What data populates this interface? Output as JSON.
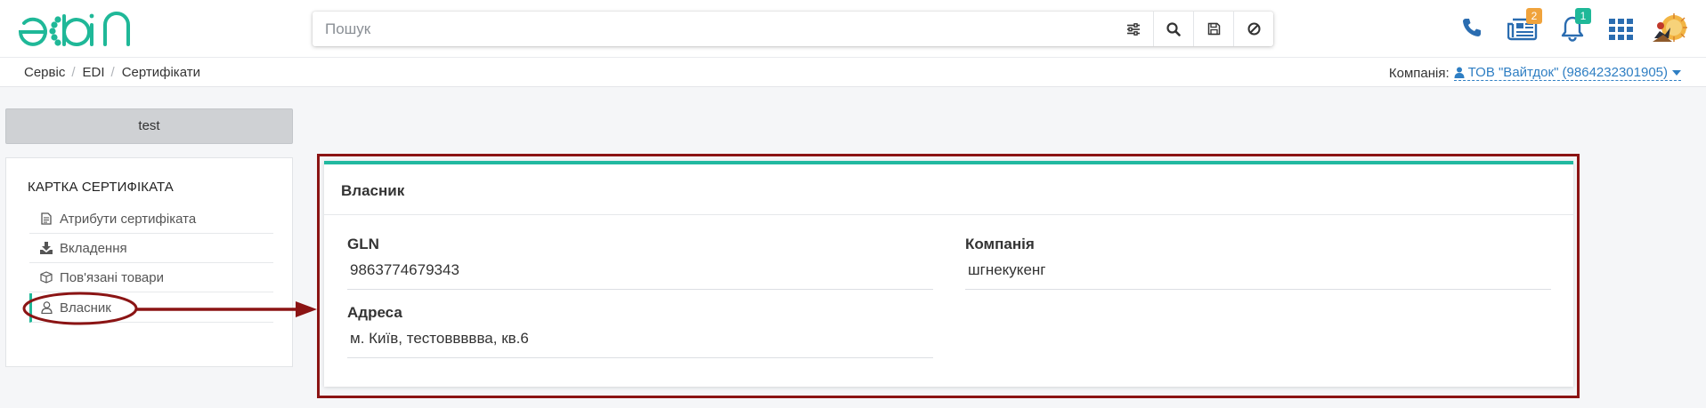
{
  "header": {
    "logo_text": "edin",
    "search": {
      "placeholder": "Пошук",
      "value": ""
    },
    "search_buttons": [
      "filter-icon",
      "search-icon",
      "save-icon",
      "clear-icon"
    ],
    "icons": {
      "phone": "phone-icon",
      "news": {
        "icon": "news-icon",
        "badge": "2",
        "badge_color": "#f0a33c"
      },
      "notifications": {
        "icon": "bell-icon",
        "badge": "1",
        "badge_color": "#1fb898"
      },
      "apps": "apps-grid-icon",
      "avatar": "avatar"
    }
  },
  "breadcrumb": {
    "items": [
      "Сервіс",
      "EDI",
      "Сертифікати"
    ],
    "company_label": "Компанія:",
    "company_value": "ТОВ \"Вайтдок\" (9864232301905)"
  },
  "sidebar": {
    "top_button": "test",
    "title": "КАРТКА СЕРТИФІКАТА",
    "items": [
      {
        "label": "Атрибути сертифіката",
        "icon": "document-icon"
      },
      {
        "label": "Вкладення",
        "icon": "download-icon"
      },
      {
        "label": "Пов'язані товари",
        "icon": "box-icon"
      },
      {
        "label": "Власник",
        "icon": "user-icon",
        "active": true
      }
    ]
  },
  "card": {
    "title": "Власник",
    "fields": {
      "gln": {
        "label": "GLN",
        "value": "9863774679343"
      },
      "company": {
        "label": "Компанія",
        "value": "шгнекукенг"
      },
      "address": {
        "label": "Адреса",
        "value": "м. Київ, тестоввввва, кв.6"
      }
    }
  },
  "colors": {
    "accent": "#1fb898",
    "link": "#2e7ec3",
    "annotation": "#8b1414",
    "icon_blue": "#2a6cb0"
  }
}
